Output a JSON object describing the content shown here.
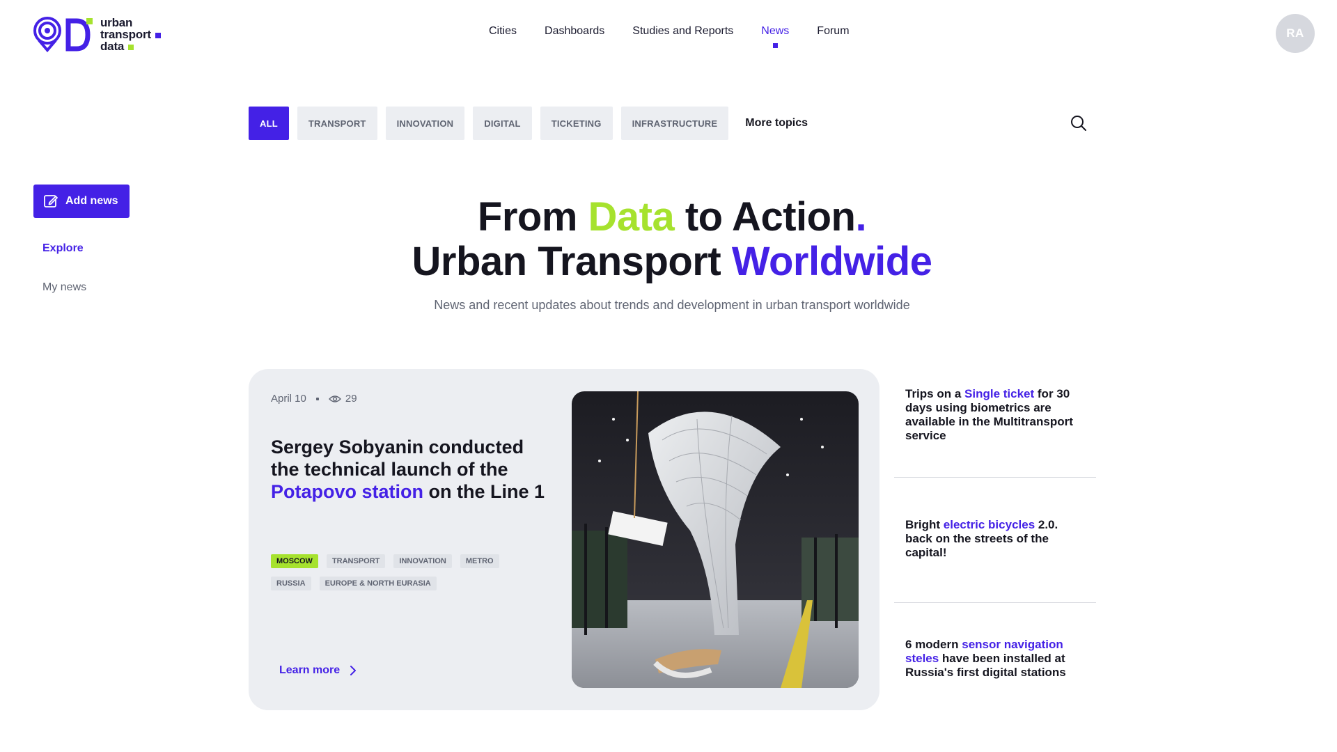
{
  "brand": {
    "line1": "urban",
    "line2": "transport",
    "line3": "data",
    "colors": {
      "primary": "#4421e6",
      "accent": "#a6e22e"
    }
  },
  "nav": {
    "items": [
      {
        "label": "Cities"
      },
      {
        "label": "Dashboards"
      },
      {
        "label": "Studies and Reports"
      },
      {
        "label": "News",
        "active": true
      },
      {
        "label": "Forum"
      }
    ]
  },
  "user": {
    "initials": "RA"
  },
  "topics": {
    "items": [
      {
        "label": "ALL",
        "active": true
      },
      {
        "label": "TRANSPORT"
      },
      {
        "label": "INNOVATION"
      },
      {
        "label": "DIGITAL"
      },
      {
        "label": "TICKETING"
      },
      {
        "label": "INFRASTRUCTURE"
      }
    ],
    "more_label": "More topics",
    "search_icon": "search-icon"
  },
  "sidebar": {
    "add_news": "Add news",
    "explore": "Explore",
    "my_news": "My news"
  },
  "hero": {
    "line1_a": "From ",
    "line1_b": "Data",
    "line1_c": " to Action",
    "line1_d": ".",
    "line2_a": "Urban Transport ",
    "line2_b": "Worldwide",
    "subtitle": "News and recent updates about trends and development in urban transport worldwide"
  },
  "featured": {
    "date": "April 10",
    "views": "29",
    "title_a": "Sergey Sobyanin conducted the technical launch of the ",
    "title_b": "Potapovo station",
    "title_c": " on the Line 1",
    "tags": [
      "MOSCOW",
      "TRANSPORT",
      "INNOVATION",
      "METRO",
      "RUSSIA",
      "EUROPE & NORTH EURASIA"
    ],
    "learn_more": "Learn more"
  },
  "side_news": [
    {
      "a": "Trips on a ",
      "b": "Single ticket",
      "c": " for 30 days using biometrics are available in the Multitransport service"
    },
    {
      "a": "Bright ",
      "b": "electric bicycles",
      "c": " 2.0. back on the streets of the capital!"
    },
    {
      "a": "6 modern ",
      "b": "sensor navigation steles",
      "c": " have been installed at Russia's first digital stations"
    }
  ]
}
